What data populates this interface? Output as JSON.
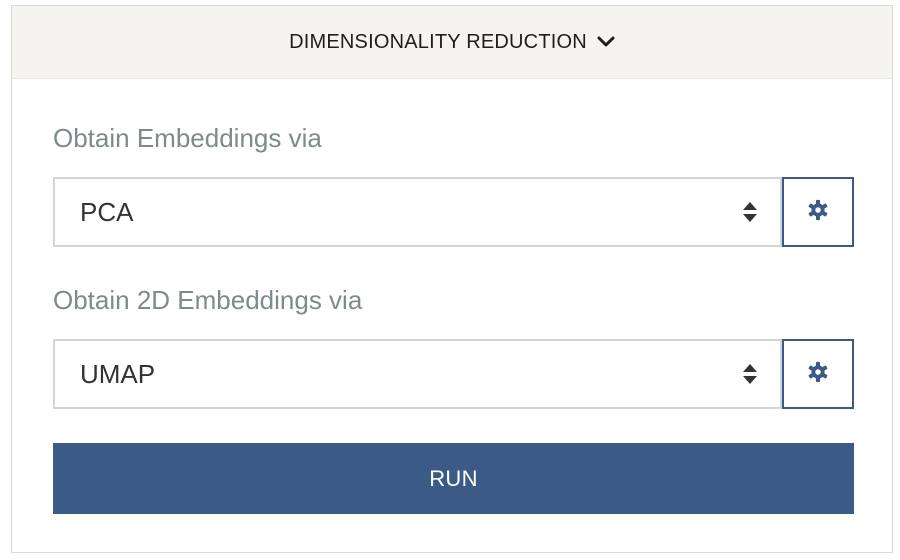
{
  "panel": {
    "title": "DIMENSIONALITY REDUCTION",
    "collapse_icon": "chevron-down-icon"
  },
  "embeddings": {
    "label": "Obtain Embeddings via",
    "selected": "PCA",
    "settings_icon": "gear-icon"
  },
  "embeddings_2d": {
    "label": "Obtain 2D Embeddings via",
    "selected": "UMAP",
    "settings_icon": "gear-icon"
  },
  "run": {
    "label": "RUN"
  },
  "colors": {
    "accent": "#3c5a86",
    "header_bg": "#f6f4f0",
    "label_text": "#7f8a8a"
  }
}
